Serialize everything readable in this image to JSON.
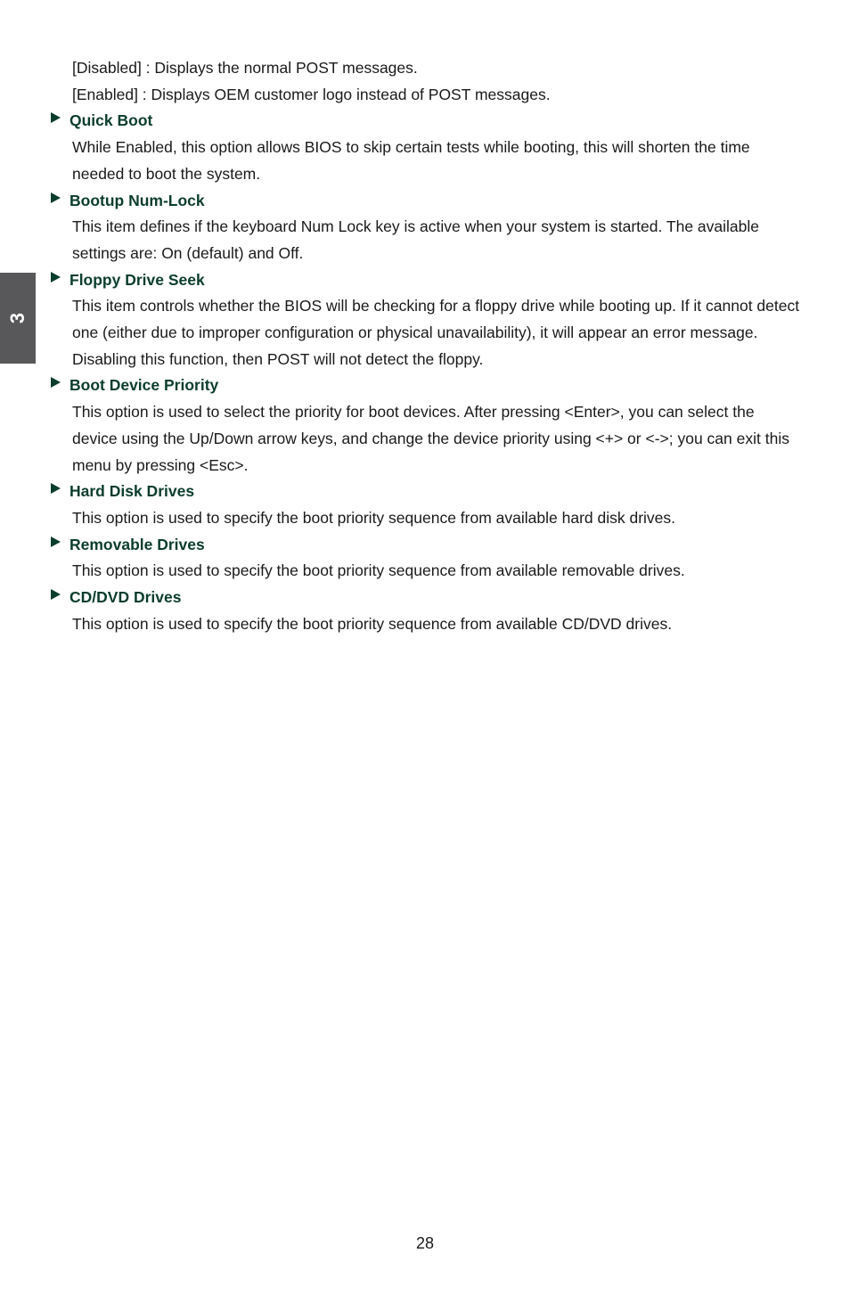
{
  "page": {
    "number": "28",
    "chapter_tab": "3",
    "colors": {
      "heading_green": "#0b3d2c",
      "tab_gray": "#58585a",
      "body_text": "#1a1a1a",
      "background": "#ffffff"
    }
  },
  "content": [
    {
      "type": "paragraph",
      "text": "[Disabled] : Displays the normal POST messages."
    },
    {
      "type": "paragraph",
      "text": "[Enabled] : Displays OEM customer logo instead of POST messages."
    },
    {
      "type": "heading",
      "text": "Quick Boot"
    },
    {
      "type": "paragraph",
      "text": "While Enabled, this option allows BIOS to skip certain tests while booting, this will shorten the time needed to boot the system."
    },
    {
      "type": "heading",
      "text": "Bootup Num-Lock"
    },
    {
      "type": "paragraph",
      "text": "This item defines if the keyboard Num Lock key is active when your system is started. The available settings are: On (default) and Off."
    },
    {
      "type": "heading",
      "text": "Floppy Drive Seek"
    },
    {
      "type": "paragraph",
      "text": "This item controls whether the BIOS will be checking for a floppy drive while booting up. If it cannot detect one (either due to improper configuration or physical unavailability), it will appear an error message. Disabling this function, then POST will not detect the floppy."
    },
    {
      "type": "heading",
      "text": "Boot Device Priority"
    },
    {
      "type": "paragraph",
      "text": "This option is used to select the priority for boot devices. After pressing <Enter>, you can select the device using the Up/Down arrow keys, and change the device priority using <+> or <->; you can exit this menu by pressing <Esc>."
    },
    {
      "type": "heading",
      "text": "Hard Disk Drives"
    },
    {
      "type": "paragraph",
      "text": "This option is used to specify the boot priority sequence from available hard disk drives."
    },
    {
      "type": "heading",
      "text": "Removable Drives"
    },
    {
      "type": "paragraph",
      "text": "This option is used to specify the boot priority sequence from available removable drives."
    },
    {
      "type": "heading",
      "text": "CD/DVD Drives"
    },
    {
      "type": "paragraph",
      "text": "This option is used to specify the boot priority sequence from available CD/DVD drives."
    }
  ]
}
